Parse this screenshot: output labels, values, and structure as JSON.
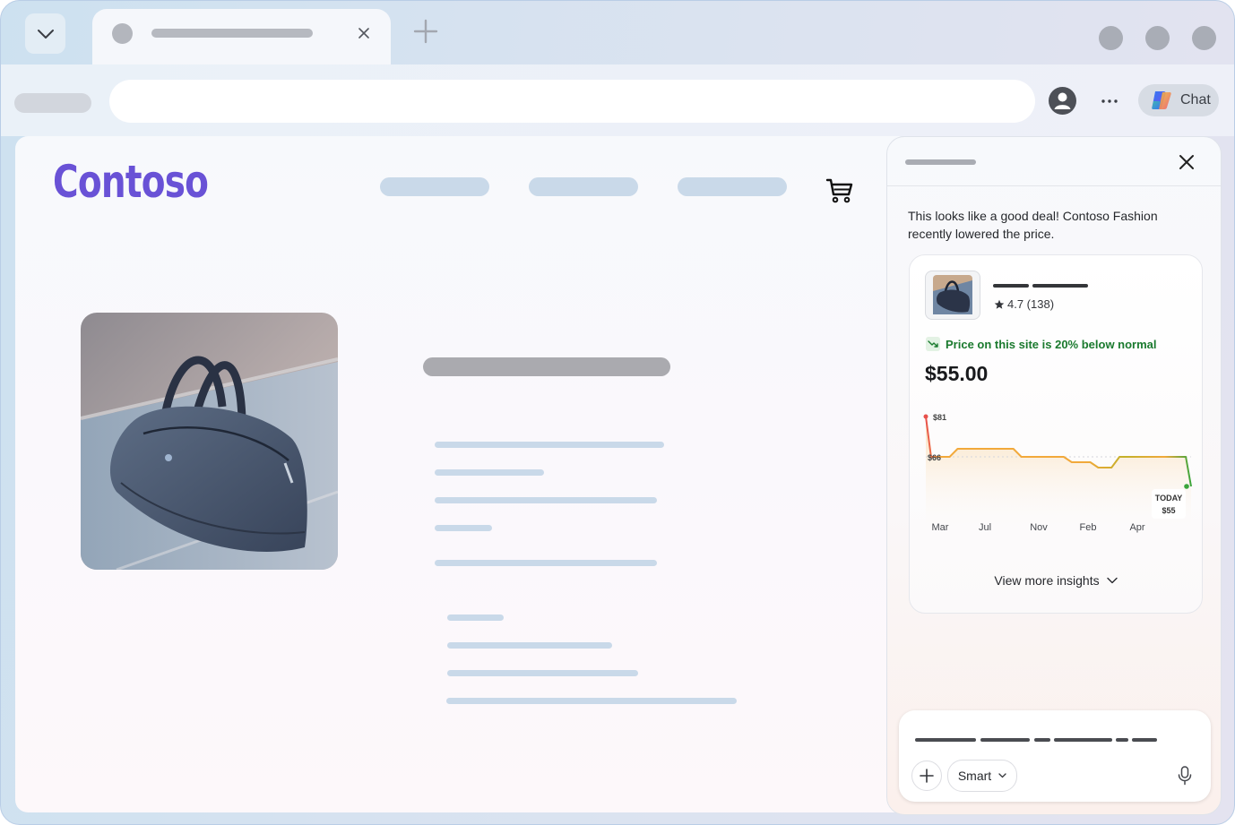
{
  "browser": {
    "chat_button_label": "Chat",
    "more_label": "..."
  },
  "site": {
    "logo_text": "Contoso"
  },
  "sidebar": {
    "message": "This looks like a good deal! Contoso Fashion recently lowered the price.",
    "product": {
      "rating": "4.7 (138)",
      "deal_text": "Price on this site is 20% below normal",
      "price": "$55.00"
    },
    "view_more_label": "View more insights",
    "composer": {
      "mode_label": "Smart"
    }
  },
  "colors": {
    "logo": "#6952d6",
    "deal_green": "#1a7a2e",
    "chart_high": "#e8504b",
    "chart_mid": "#f2a93b",
    "chart_low": "#c3b02a",
    "chart_today": "#3aa53b"
  },
  "chart_data": {
    "type": "line",
    "title": "",
    "x_labels": [
      "Mar",
      "Jul",
      "Nov",
      "Feb",
      "Apr"
    ],
    "points": [
      {
        "x": 0.0,
        "y": 81
      },
      {
        "x": 0.02,
        "y": 66
      },
      {
        "x": 0.09,
        "y": 66
      },
      {
        "x": 0.12,
        "y": 69
      },
      {
        "x": 0.33,
        "y": 69
      },
      {
        "x": 0.36,
        "y": 66
      },
      {
        "x": 0.52,
        "y": 66
      },
      {
        "x": 0.55,
        "y": 64
      },
      {
        "x": 0.62,
        "y": 64
      },
      {
        "x": 0.65,
        "y": 62
      },
      {
        "x": 0.7,
        "y": 62
      },
      {
        "x": 0.73,
        "y": 66
      },
      {
        "x": 0.98,
        "y": 66
      },
      {
        "x": 1.0,
        "y": 55
      }
    ],
    "ylim": [
      50,
      84
    ],
    "annotations": [
      {
        "label": "$81",
        "y": 81
      },
      {
        "label": "$66",
        "y": 66
      }
    ],
    "today_label": "TODAY",
    "today_value": "$55"
  }
}
